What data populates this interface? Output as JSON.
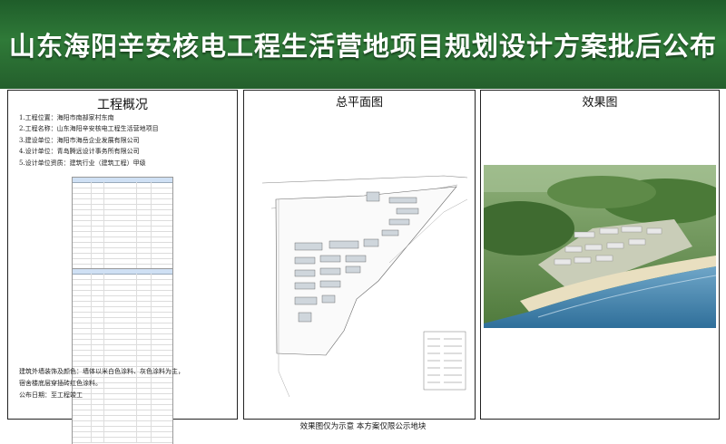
{
  "banner": {
    "title": "山东海阳辛安核电工程生活营地项目规划设计方案批后公布",
    "color": "#2f7a38"
  },
  "overview": {
    "title": "工程概况",
    "items": [
      "1.工程位置：海阳市南部家村东南",
      "2.工程名称：山东海阳辛安核电工程生活营地项目",
      "3.建设单位：海阳市海岳企业发展有限公司",
      "4.设计单位：青岛腾远设计事务所有限公司",
      "5.设计单位资质：建筑行业（建筑工程）甲级"
    ],
    "description": [
      "建筑外墙装饰及颜色：墙体以米白色涂料、灰色涂料为主，",
      "宿舍楼底层穿插砖红色涂料。",
      "公布日期：至工程竣工"
    ]
  },
  "plan": {
    "title": "总平面图"
  },
  "render": {
    "title": "效果图"
  },
  "footer": {
    "note": "效果图仅为示意 本方案仅限公示地块"
  }
}
